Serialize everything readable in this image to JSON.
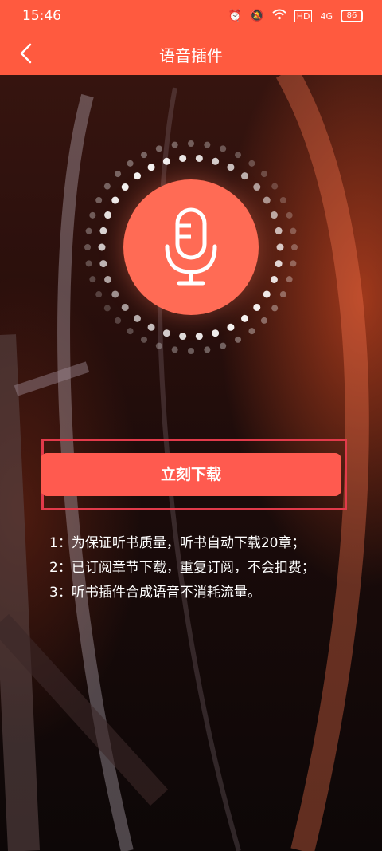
{
  "status_bar": {
    "time": "15:46",
    "network": "HD",
    "signal": "4G",
    "battery": "86"
  },
  "header": {
    "title": "语音插件"
  },
  "download": {
    "label": "立刻下载"
  },
  "notes": [
    "1：为保证听书质量，听书自动下载20章；",
    "2：已订阅章节下载，重复订阅，不会扣费；",
    "3：听书插件合成语音不消耗流量。"
  ],
  "colors": {
    "accent": "#ff5a3f",
    "button": "#ff5a4f",
    "highlight_frame": "#e23a4a",
    "mic_circle": "#ff6b55"
  },
  "icons": {
    "back": "chevron-left-icon",
    "mic": "microphone-icon"
  }
}
